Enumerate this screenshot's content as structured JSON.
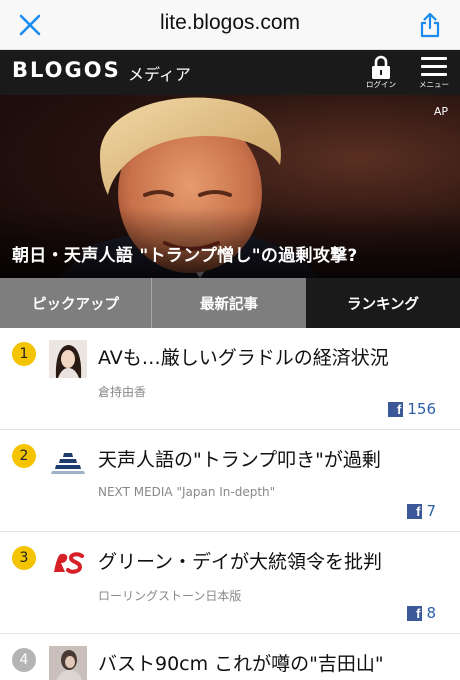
{
  "browser": {
    "url": "lite.blogos.com"
  },
  "site": {
    "logo": "BLOGOS",
    "section": "メディア",
    "login_label": "ログイン",
    "menu_label": "メニュー"
  },
  "hero": {
    "credit": "AP",
    "title": "朝日・天声人語 \"トランプ憎し\"の過剰攻撃?"
  },
  "tabs": [
    {
      "label": "ピックアップ",
      "active": false
    },
    {
      "label": "最新記事",
      "active": false
    },
    {
      "label": "ランキング",
      "active": true
    }
  ],
  "articles": [
    {
      "rank": "1",
      "title": "AVも…厳しいグラドルの経済状況",
      "source": "倉持由香",
      "likes": "156"
    },
    {
      "rank": "2",
      "title": "天声人語の\"トランプ叩き\"が過剰",
      "source": "NEXT MEDIA \"Japan In-depth\"",
      "likes": "7"
    },
    {
      "rank": "3",
      "title": "グリーン・デイが大統領令を批判",
      "source": "ローリングストーン日本版",
      "likes": "8"
    },
    {
      "rank": "4",
      "title": "バスト90cm これが噂の\"吉田山\"",
      "source": "",
      "likes": ""
    }
  ],
  "colors": {
    "rank_badge": "#f4c400",
    "rank_badge_inactive": "#b4b4b4",
    "header_bg": "#1a1a1a",
    "tab_inactive": "#7e7e7e",
    "facebook": "#3b5998"
  }
}
